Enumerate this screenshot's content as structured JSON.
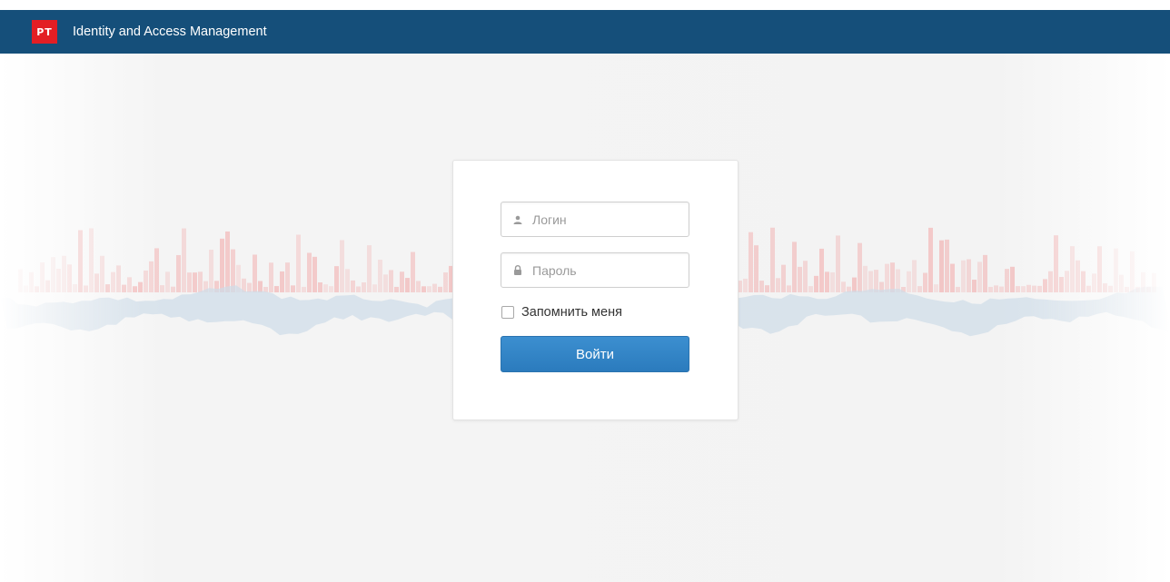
{
  "header": {
    "logo_text": "PT",
    "title": "Identity and Access Management"
  },
  "login_form": {
    "login_placeholder": "Логин",
    "password_placeholder": "Пароль",
    "remember_label": "Запомнить меня",
    "remember_checked": false,
    "submit_label": "Войти"
  },
  "icons": {
    "logo": "pt-logo",
    "login_field": "user-icon",
    "password_field": "lock-icon"
  },
  "colors": {
    "header_bg": "#154f7a",
    "logo_bg": "#e31e24",
    "button_bg": "#3384c6",
    "wave_red": "#f2a8a8",
    "wave_blue": "#cfdde9"
  }
}
